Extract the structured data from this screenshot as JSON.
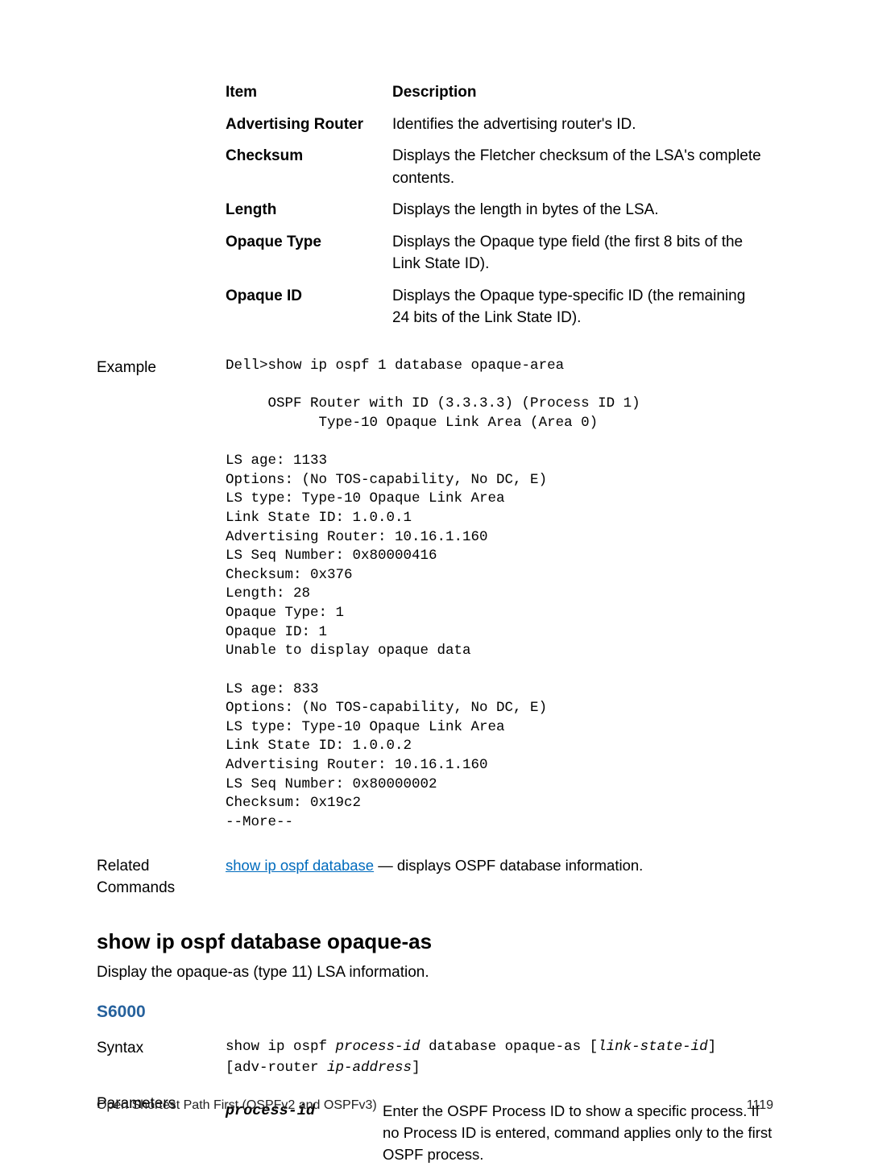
{
  "table1": {
    "head": {
      "item": "Item",
      "desc": "Description"
    },
    "rows": [
      {
        "item": "Advertising Router",
        "desc": "Identifies the advertising router's ID."
      },
      {
        "item": "Checksum",
        "desc": "Displays the Fletcher checksum of the LSA's complete contents."
      },
      {
        "item": "Length",
        "desc": "Displays the length in bytes of the LSA."
      },
      {
        "item": "Opaque Type",
        "desc": "Displays the Opaque type field (the first 8 bits of the Link State ID)."
      },
      {
        "item": "Opaque ID",
        "desc": "Displays the Opaque type-specific ID (the remaining 24 bits of the Link State ID)."
      }
    ]
  },
  "labels": {
    "example": "Example",
    "related": "Related Commands",
    "syntax": "Syntax",
    "parameters": "Parameters"
  },
  "example_output": "Dell>show ip ospf 1 database opaque-area\n\n     OSPF Router with ID (3.3.3.3) (Process ID 1)\n           Type-10 Opaque Link Area (Area 0)\n\nLS age: 1133\nOptions: (No TOS-capability, No DC, E)\nLS type: Type-10 Opaque Link Area\nLink State ID: 1.0.0.1\nAdvertising Router: 10.16.1.160\nLS Seq Number: 0x80000416\nChecksum: 0x376\nLength: 28\nOpaque Type: 1\nOpaque ID: 1\nUnable to display opaque data\n\nLS age: 833\nOptions: (No TOS-capability, No DC, E)\nLS type: Type-10 Opaque Link Area\nLink State ID: 1.0.0.2\nAdvertising Router: 10.16.1.160\nLS Seq Number: 0x80000002\nChecksum: 0x19c2\n--More--",
  "related": {
    "link_text": "show ip ospf database",
    "rest": " — displays OSPF database information."
  },
  "section2": {
    "heading": "show ip ospf database opaque-as",
    "desc": "Display the opaque-as (type 11) LSA information.",
    "model": "S6000",
    "syntax": {
      "l1a": "show ip ospf ",
      "l1b": "process-id",
      "l1c": " database opaque-as [",
      "l1d": "link-state-id",
      "l1e": "]",
      "l2a": "[adv-router ",
      "l2b": "ip-address",
      "l2c": "]"
    },
    "param": {
      "name": "process-id",
      "desc": "Enter the OSPF Process ID to show a specific process. If no Process ID is entered, command applies only to the first OSPF process."
    }
  },
  "footer": {
    "left": "Open Shortest Path First (OSPFv2 and OSPFv3)",
    "right": "1119"
  }
}
